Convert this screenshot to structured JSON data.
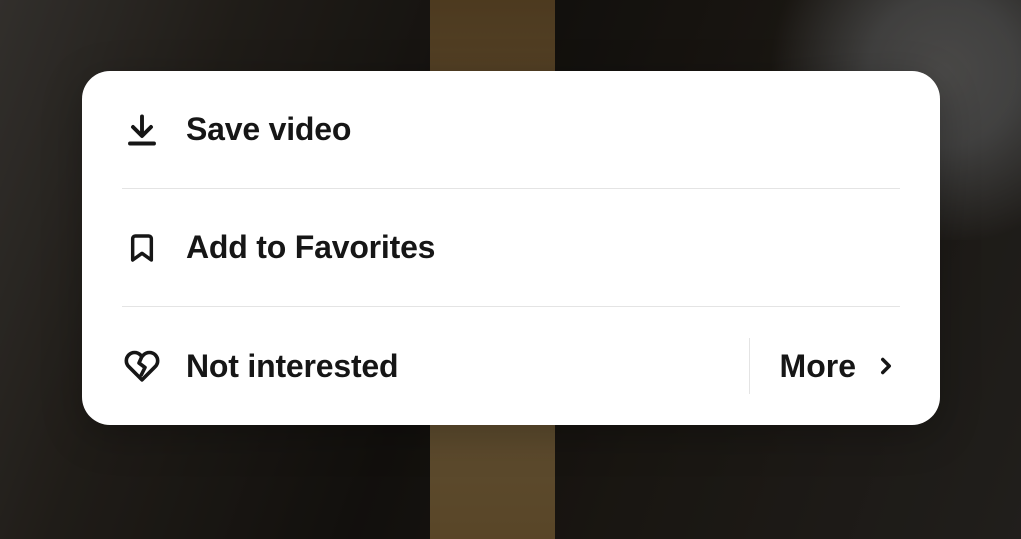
{
  "menu": {
    "save": {
      "label": "Save video"
    },
    "favorites": {
      "label": "Add to Favorites"
    },
    "notInterested": {
      "label": "Not interested"
    },
    "more": {
      "label": "More"
    }
  }
}
